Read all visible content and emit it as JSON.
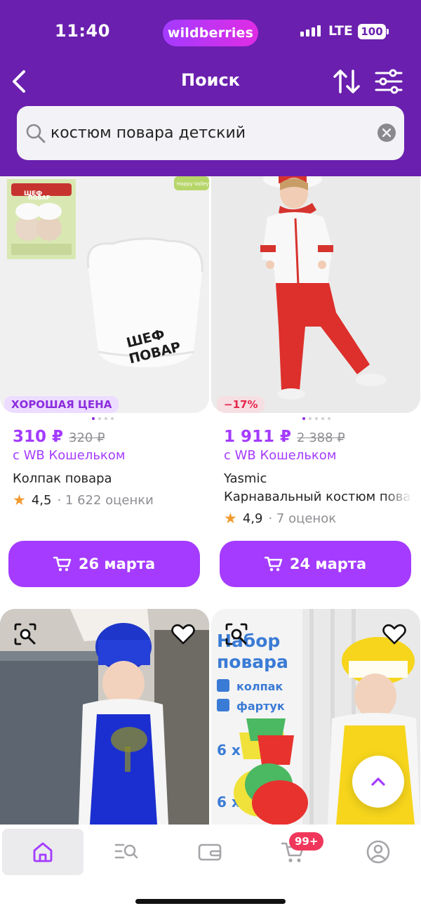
{
  "status_bar": {
    "time": "11:40",
    "brand": "wildberries",
    "network": "LTE",
    "battery": "100"
  },
  "header": {
    "title": "Поиск",
    "back_icon": "chevron-left-icon",
    "sort_icon": "sort-arrows-icon",
    "filter_icon": "sliders-icon"
  },
  "search": {
    "value": "костюм повара детский",
    "placeholder": ""
  },
  "products": [
    {
      "badge": "ХОРОШАЯ ЦЕНА",
      "price": "310 ₽",
      "old_price": "320 ₽",
      "wallet": "с WB Кошельком",
      "name": "Колпак повара",
      "brand": "",
      "rating": "4,5",
      "reviews": "· 1 622 оценки",
      "delivery": "26 марта",
      "image_text": [
        "ШЕФ",
        "ПОВАР",
        "ШЕФ",
        "ПОВАР",
        "Happy Valley"
      ]
    },
    {
      "badge": "−17%",
      "price": "1 911 ₽",
      "old_price": "2 388 ₽",
      "wallet": "с WB Кошельком",
      "brand": "Yasmic",
      "name": "Карнавальный костюм повара",
      "rating": "4,9",
      "reviews": "· 7 оценок",
      "delivery": "24 марта"
    },
    {
      "image": "child-blue-chef"
    },
    {
      "image_text": [
        "Набор",
        "повара",
        "колпак",
        "фартук",
        "6 x",
        "6 x"
      ]
    }
  ],
  "tabbar": {
    "items": [
      "home-icon",
      "catalog-search-icon",
      "wallet-icon",
      "cart-icon",
      "profile-icon"
    ],
    "cart_count": "99+"
  },
  "colors": {
    "header": "#6a1fae",
    "accent": "#a43bff",
    "sale": "#e6274d",
    "star": "#f29a2e"
  }
}
